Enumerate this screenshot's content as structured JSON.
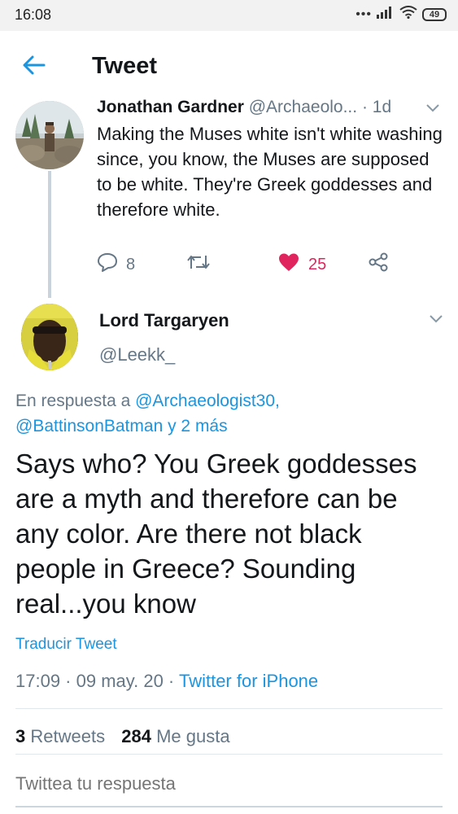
{
  "status_bar": {
    "time": "16:08",
    "battery": "49",
    "icons": [
      "dots-icon",
      "signal-icon",
      "wifi-icon",
      "battery-icon"
    ]
  },
  "header": {
    "title": "Tweet",
    "back_icon": "arrow-left-icon"
  },
  "parent_tweet": {
    "name": "Jonathan Gardner",
    "handle": "@Archaeolo...",
    "time": "· 1d",
    "text": "Making the Muses white isn't white washing since, you know, the Muses are supposed to be white. They're Greek goddesses and therefore white.",
    "replies": "8",
    "likes": "25",
    "icons": [
      "reply-icon",
      "retweet-icon",
      "heart-icon",
      "share-icon",
      "chevron-down-icon"
    ]
  },
  "main_tweet": {
    "name": "Lord Targaryen",
    "handle": "@Leekk_",
    "reply_prefix": "En respuesta a",
    "reply_user1": "@Archaeologist30",
    "reply_comma": ",",
    "reply_user2": "@BattinsonBatman",
    "reply_more": "y 2 más",
    "text": "Says who? You Greek goddesses are a myth and therefore can be any color. Are there not black people in Greece? Sounding real...you know",
    "translate": "Traducir Tweet",
    "timestamp": "17:09 · 09 may. 20 · ",
    "source": "Twitter for iPhone"
  },
  "stats": {
    "retweets_count": "3",
    "retweets_label": "Retweets",
    "likes_count": "284",
    "likes_label": "Me gusta"
  },
  "reply_bar": {
    "placeholder": "Twittea tu respuesta"
  },
  "colors": {
    "accent": "#1b95e0",
    "like": "#e0245e",
    "muted": "#657786",
    "text": "#14171a"
  }
}
